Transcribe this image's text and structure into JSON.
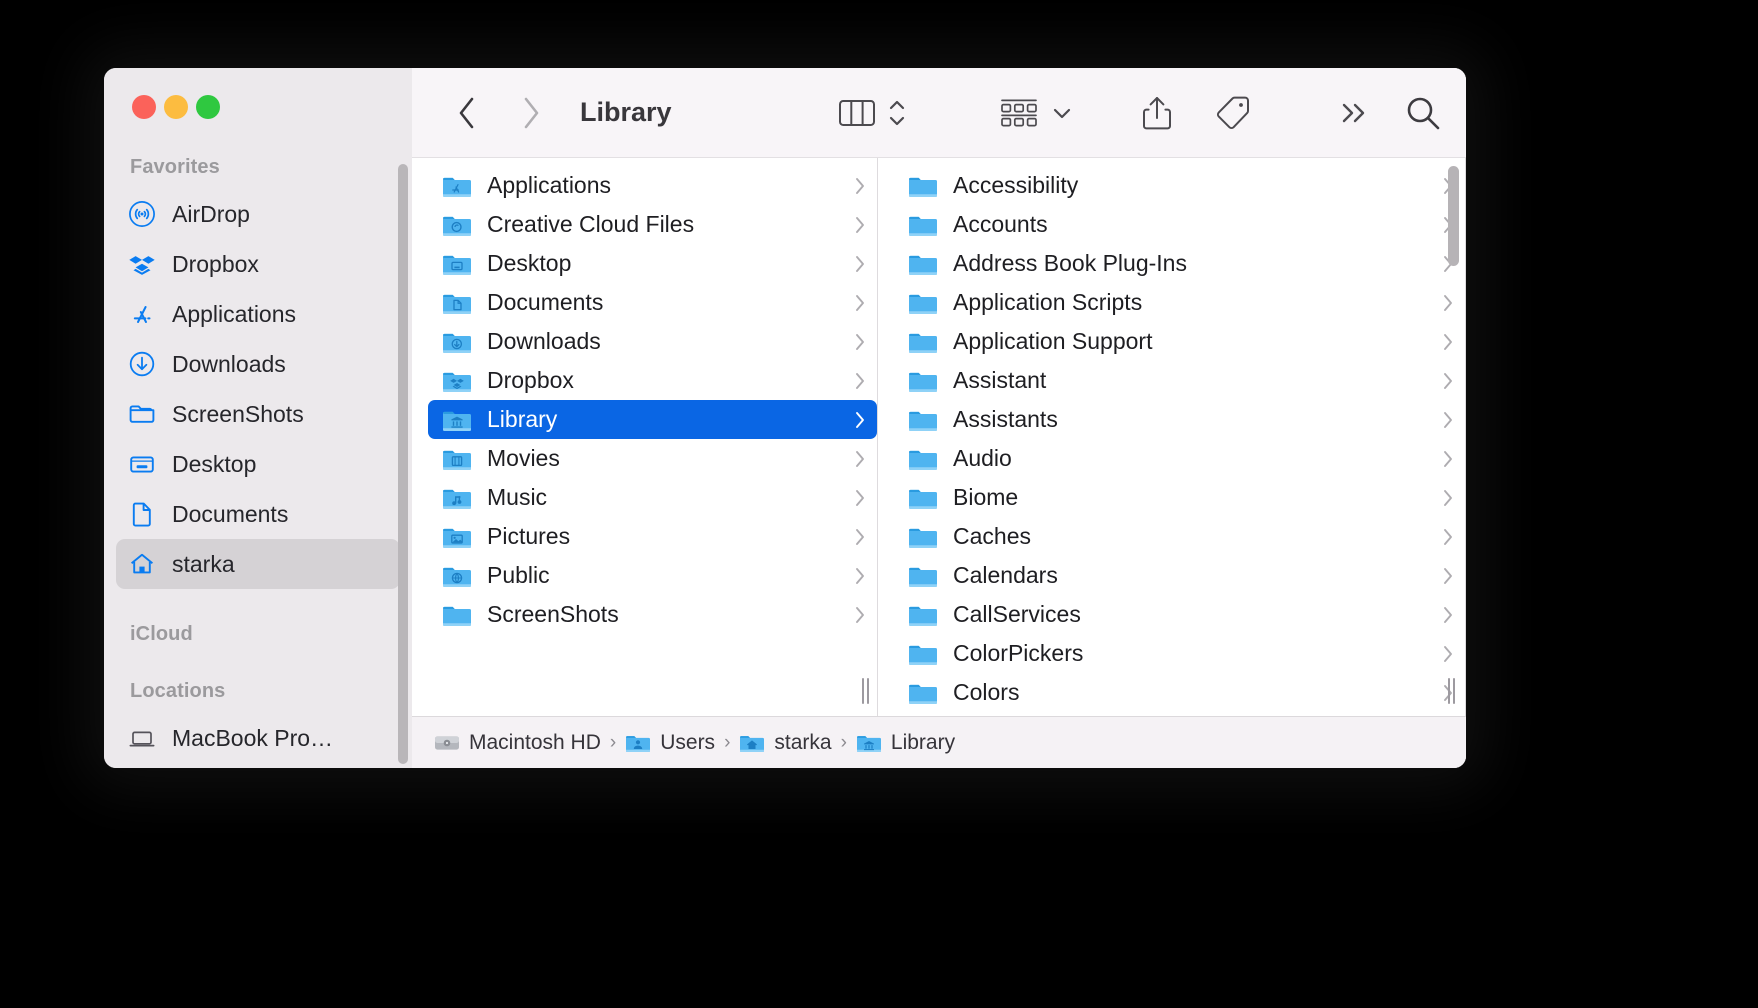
{
  "window": {
    "title": "Library",
    "traffic_lights": [
      {
        "name": "close",
        "color": "#fb625a"
      },
      {
        "name": "minimize",
        "color": "#fcbc40"
      },
      {
        "name": "maximize",
        "color": "#2fc840"
      }
    ]
  },
  "toolbar": {
    "back_icon": "chevron-left-icon",
    "forward_icon": "chevron-right-icon",
    "view_icon": "column-view-icon",
    "view_sort_icon": "up-down-chevrons-icon",
    "group_icon": "group-items-icon",
    "group_chevron_icon": "chevron-down-icon",
    "share_icon": "share-icon",
    "tag_icon": "tag-icon",
    "more_icon": "double-chevron-right-icon",
    "search_icon": "search-icon"
  },
  "sidebar": {
    "sections": [
      {
        "header": "Favorites",
        "items": [
          {
            "label": "AirDrop",
            "icon": "airdrop-icon",
            "selected": false
          },
          {
            "label": "Dropbox",
            "icon": "dropbox-icon",
            "selected": false
          },
          {
            "label": "Applications",
            "icon": "app-store-icon",
            "selected": false
          },
          {
            "label": "Downloads",
            "icon": "download-icon",
            "selected": false
          },
          {
            "label": "ScreenShots",
            "icon": "folder-icon",
            "selected": false
          },
          {
            "label": "Desktop",
            "icon": "desktop-icon",
            "selected": false
          },
          {
            "label": "Documents",
            "icon": "document-icon",
            "selected": false
          },
          {
            "label": "starka",
            "icon": "home-icon",
            "selected": true
          }
        ]
      },
      {
        "header": "iCloud",
        "items": []
      },
      {
        "header": "Locations",
        "items": [
          {
            "label": "MacBook Pro…",
            "icon": "laptop-icon",
            "selected": false
          }
        ]
      }
    ]
  },
  "columns": [
    {
      "name": "column-home",
      "items": [
        {
          "label": "Applications",
          "icon": "folder-applications",
          "selected": false,
          "has_chevron": true
        },
        {
          "label": "Creative Cloud Files",
          "icon": "folder-creativecloud",
          "selected": false,
          "has_chevron": true
        },
        {
          "label": "Desktop",
          "icon": "folder-desktop",
          "selected": false,
          "has_chevron": true
        },
        {
          "label": "Documents",
          "icon": "folder-documents",
          "selected": false,
          "has_chevron": true
        },
        {
          "label": "Downloads",
          "icon": "folder-downloads",
          "selected": false,
          "has_chevron": true
        },
        {
          "label": "Dropbox",
          "icon": "folder-dropbox",
          "selected": false,
          "has_chevron": true
        },
        {
          "label": "Library",
          "icon": "folder-library",
          "selected": true,
          "has_chevron": true
        },
        {
          "label": "Movies",
          "icon": "folder-movies",
          "selected": false,
          "has_chevron": true
        },
        {
          "label": "Music",
          "icon": "folder-music",
          "selected": false,
          "has_chevron": true
        },
        {
          "label": "Pictures",
          "icon": "folder-pictures",
          "selected": false,
          "has_chevron": true
        },
        {
          "label": "Public",
          "icon": "folder-public",
          "selected": false,
          "has_chevron": true
        },
        {
          "label": "ScreenShots",
          "icon": "folder-plain",
          "selected": false,
          "has_chevron": true
        }
      ]
    },
    {
      "name": "column-library",
      "items": [
        {
          "label": "Accessibility",
          "icon": "folder-plain",
          "selected": false,
          "has_chevron": true
        },
        {
          "label": "Accounts",
          "icon": "folder-plain",
          "selected": false,
          "has_chevron": true
        },
        {
          "label": "Address Book Plug-Ins",
          "icon": "folder-plain",
          "selected": false,
          "has_chevron": true
        },
        {
          "label": "Application Scripts",
          "icon": "folder-plain",
          "selected": false,
          "has_chevron": true
        },
        {
          "label": "Application Support",
          "icon": "folder-plain",
          "selected": false,
          "has_chevron": true
        },
        {
          "label": "Assistant",
          "icon": "folder-plain",
          "selected": false,
          "has_chevron": true
        },
        {
          "label": "Assistants",
          "icon": "folder-plain",
          "selected": false,
          "has_chevron": true
        },
        {
          "label": "Audio",
          "icon": "folder-plain",
          "selected": false,
          "has_chevron": true
        },
        {
          "label": "Biome",
          "icon": "folder-plain",
          "selected": false,
          "has_chevron": true
        },
        {
          "label": "Caches",
          "icon": "folder-plain",
          "selected": false,
          "has_chevron": true
        },
        {
          "label": "Calendars",
          "icon": "folder-plain",
          "selected": false,
          "has_chevron": true
        },
        {
          "label": "CallServices",
          "icon": "folder-plain",
          "selected": false,
          "has_chevron": true
        },
        {
          "label": "ColorPickers",
          "icon": "folder-plain",
          "selected": false,
          "has_chevron": true
        },
        {
          "label": "Colors",
          "icon": "folder-plain",
          "selected": false,
          "has_chevron": true
        }
      ]
    }
  ],
  "pathbar": {
    "crumbs": [
      {
        "label": "Macintosh HD",
        "icon": "harddisk-icon"
      },
      {
        "label": "Users",
        "icon": "folder-users-icon"
      },
      {
        "label": "starka",
        "icon": "folder-home-icon"
      },
      {
        "label": "Library",
        "icon": "folder-library-icon"
      }
    ],
    "separator": "›"
  },
  "colors": {
    "selection_blue": "#0a66e4",
    "sidebar_bg": "#ece9ec",
    "toolbar_bg": "#f8f5f8",
    "folder_blue": "#4fb4f0",
    "folder_blue_dark": "#2a9be0",
    "sidebar_icon_blue": "#0a7cf1",
    "pathbar_bg": "#f5f2f5"
  }
}
